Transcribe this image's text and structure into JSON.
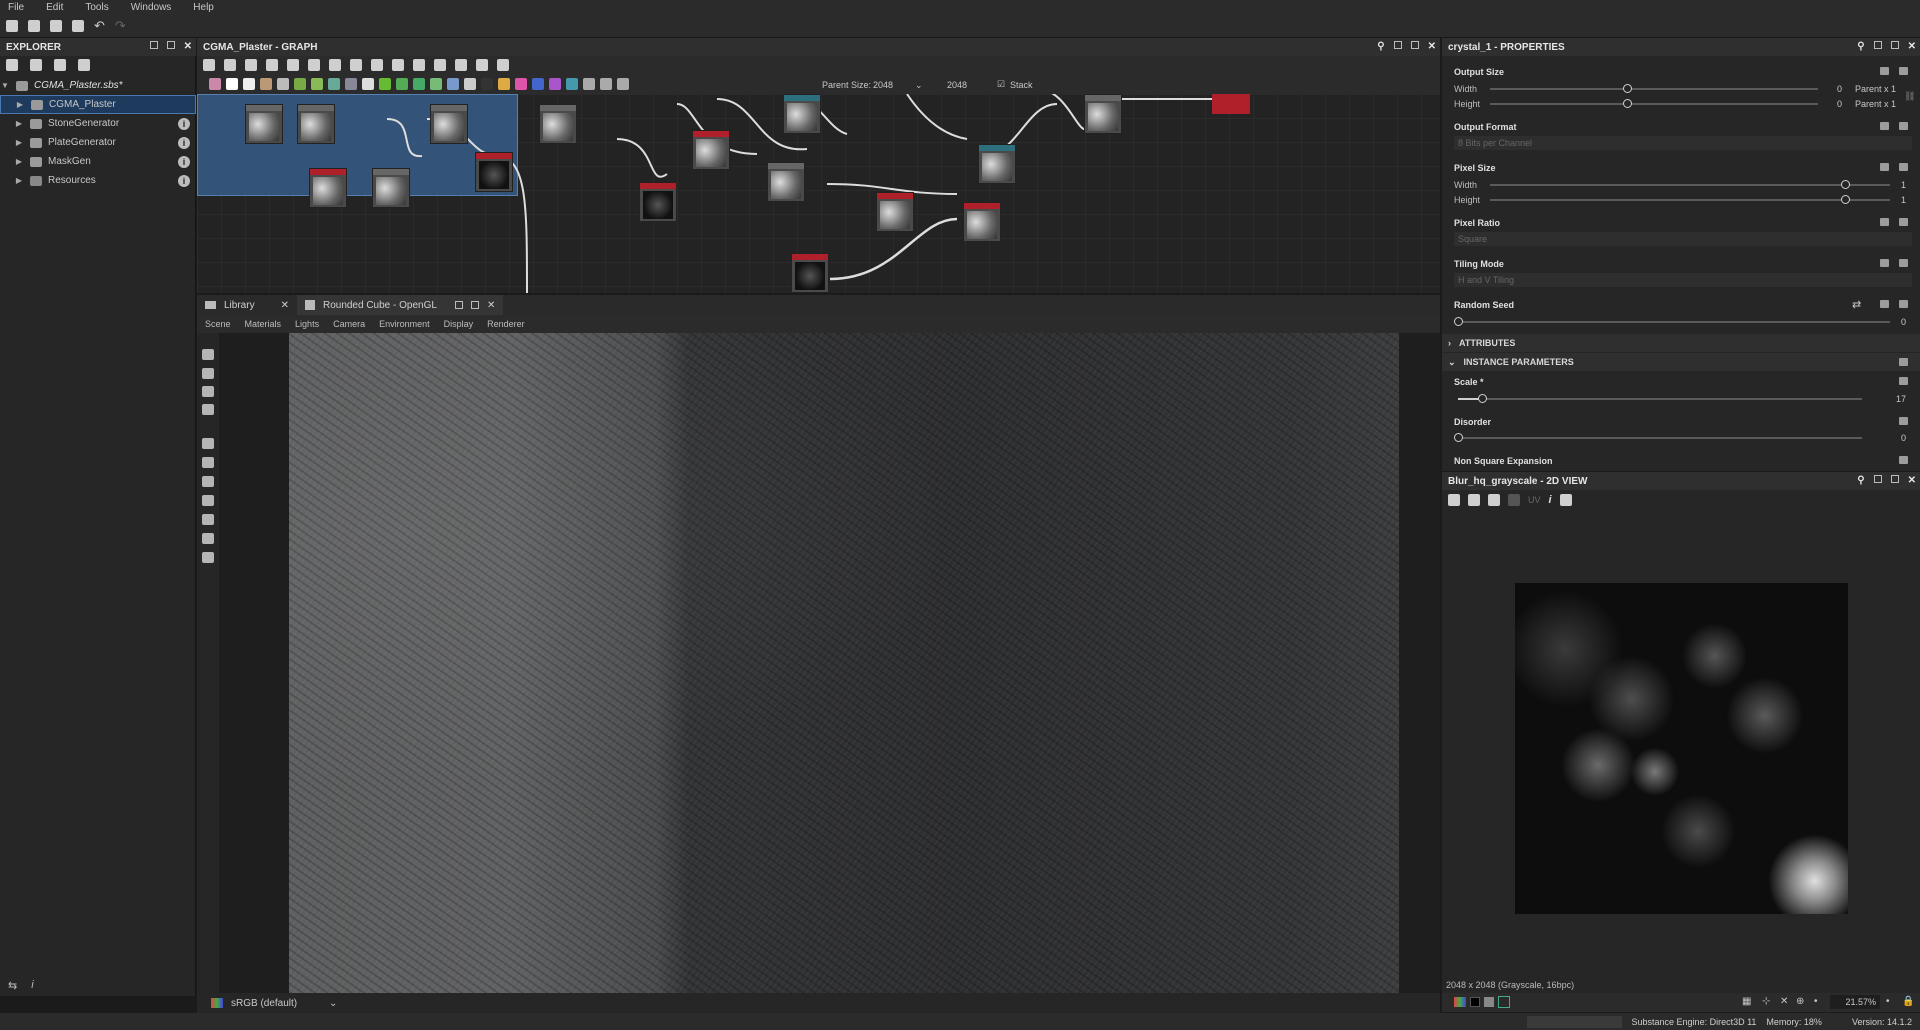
{
  "menu": [
    "File",
    "Edit",
    "Tools",
    "Windows",
    "Help"
  ],
  "explorer": {
    "title": "EXPLORER",
    "package": "CGMA_Plaster.sbs*",
    "items": [
      "CGMA_Plaster",
      "StoneGenerator",
      "PlateGenerator",
      "MaskGen",
      "Resources"
    ]
  },
  "graph": {
    "title": "CGMA_Plaster - GRAPH",
    "parent_size_label": "Parent Size:",
    "parent_size": "2048",
    "size2": "2048",
    "stack": "Stack"
  },
  "viewport": {
    "tabs": [
      "Library",
      "Rounded Cube - OpenGL"
    ],
    "menu": [
      "Scene",
      "Materials",
      "Lights",
      "Camera",
      "Environment",
      "Display",
      "Renderer"
    ],
    "colorspace": "sRGB (default)"
  },
  "properties": {
    "title": "crystal_1 - PROPERTIES",
    "output_size": {
      "label": "Output Size",
      "width_label": "Width",
      "height_label": "Height",
      "width_val": "0",
      "height_val": "0",
      "width_rel": "Parent x 1",
      "height_rel": "Parent x 1"
    },
    "output_format": {
      "label": "Output Format",
      "value": "8 Bits per Channel"
    },
    "pixel_size": {
      "label": "Pixel Size",
      "width_label": "Width",
      "height_label": "Height",
      "width_val": "1",
      "height_val": "1"
    },
    "pixel_ratio": {
      "label": "Pixel Ratio",
      "value": "Square"
    },
    "tiling_mode": {
      "label": "Tiling Mode",
      "value": "H and V Tiling"
    },
    "random_seed": {
      "label": "Random Seed",
      "value": "0"
    },
    "attributes": "ATTRIBUTES",
    "instance_parameters": "INSTANCE PARAMETERS",
    "scale": {
      "label": "Scale *",
      "value": "17"
    },
    "disorder": {
      "label": "Disorder",
      "value": "0"
    },
    "non_square": {
      "label": "Non Square Expansion"
    }
  },
  "view2d": {
    "title": "Blur_hq_grayscale - 2D VIEW",
    "info": "2048 x 2048 (Grayscale, 16bpc)",
    "zoom": "21.57%",
    "uv": "UV"
  },
  "statusbar": {
    "engine": "Substance Engine: Direct3D 11",
    "memory": "Memory: 18%",
    "version": "Version: 14.1.2"
  }
}
